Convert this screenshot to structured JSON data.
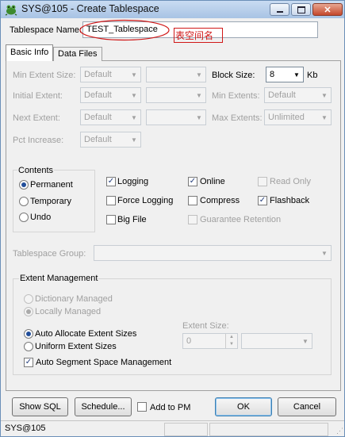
{
  "window": {
    "title": "SYS@105 - Create Tablespace",
    "app_icon": "frog-icon",
    "controls": {
      "minimize": "minimize-icon",
      "maximize": "maximize-icon",
      "close": "close-icon"
    }
  },
  "tablespace_name": {
    "label": "Tablespace Name:",
    "value": "TEST_Tablespace",
    "annotation": "表空间名"
  },
  "tabs": [
    {
      "label": "Basic Info"
    },
    {
      "label": "Data Files"
    }
  ],
  "basic_info": {
    "min_extent_size": {
      "label": "Min Extent Size:",
      "value": "Default"
    },
    "initial_extent": {
      "label": "Initial Extent:",
      "value": "Default"
    },
    "next_extent": {
      "label": "Next Extent:",
      "value": "Default"
    },
    "pct_increase": {
      "label": "Pct Increase:",
      "value": "Default"
    },
    "block_size": {
      "label": "Block Size:",
      "value": "8",
      "unit": "Kb"
    },
    "min_extents": {
      "label": "Min Extents:",
      "value": "Default"
    },
    "max_extents": {
      "label": "Max Extents:",
      "value": "Unlimited"
    },
    "contents": {
      "title": "Contents",
      "options": [
        {
          "label": "Permanent",
          "selected": true
        },
        {
          "label": "Temporary",
          "selected": false
        },
        {
          "label": "Undo",
          "selected": false
        }
      ]
    },
    "checkboxes": [
      {
        "label": "Logging",
        "checked": true,
        "enabled": true
      },
      {
        "label": "Online",
        "checked": true,
        "enabled": true
      },
      {
        "label": "Read Only",
        "checked": false,
        "enabled": false
      },
      {
        "label": "Force Logging",
        "checked": false,
        "enabled": true
      },
      {
        "label": "Compress",
        "checked": false,
        "enabled": true
      },
      {
        "label": "Flashback",
        "checked": true,
        "enabled": true
      },
      {
        "label": "Big File",
        "checked": false,
        "enabled": true
      },
      {
        "label": "Guarantee Retention",
        "checked": false,
        "enabled": false
      }
    ],
    "tablespace_group": {
      "label": "Tablespace Group:",
      "value": ""
    },
    "extent_management": {
      "title": "Extent Management",
      "dictionary_managed": {
        "label": "Dictionary Managed",
        "selected": false
      },
      "locally_managed": {
        "label": "Locally Managed",
        "selected": true
      },
      "auto_allocate": {
        "label": "Auto Allocate Extent Sizes",
        "selected": true
      },
      "uniform": {
        "label": "Uniform Extent Sizes",
        "selected": false
      },
      "extent_size": {
        "label": "Extent Size:",
        "value": "0"
      },
      "auto_segment": {
        "label": "Auto Segment Space Management",
        "checked": true
      }
    }
  },
  "footer": {
    "show_sql": "Show SQL",
    "schedule": "Schedule...",
    "add_to_pm": "Add to PM",
    "ok": "OK",
    "cancel": "Cancel"
  },
  "status_bar": {
    "connection": "SYS@105"
  },
  "colors": {
    "annotation_red": "#d01818",
    "title_bar": "#b9cfea"
  }
}
